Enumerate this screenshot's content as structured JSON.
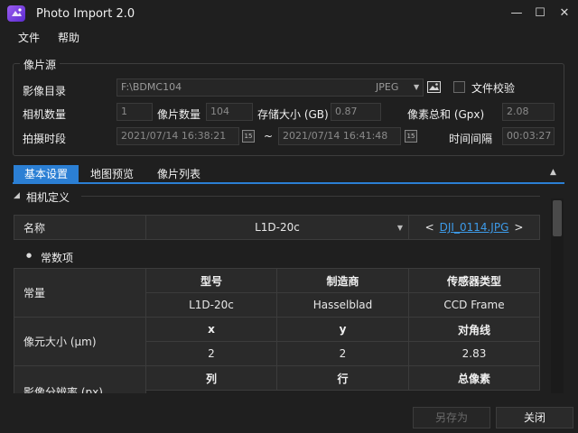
{
  "window": {
    "title": "Photo Import 2.0",
    "minimize": "—",
    "maximize": "☐",
    "close": "✕"
  },
  "menu": {
    "file": "文件",
    "help": "帮助"
  },
  "source": {
    "group_title": "像片源",
    "dir_label": "影像目录",
    "dir_value": "F:\\BDMC104",
    "format_value": "JPEG",
    "verify_label": "文件校验",
    "camera_count_label": "相机数量",
    "camera_count_value": "1",
    "photo_count_label": "像片数量",
    "photo_count_value": "104",
    "storage_label": "存储大小 (GB)",
    "storage_value": "0.87",
    "pixel_total_label": "像素总和 (Gpx)",
    "pixel_total_value": "2.08",
    "time_label": "拍摄时段",
    "time_start": "2021/07/14 16:38:21",
    "time_sep": "~",
    "time_end": "2021/07/14 16:41:48",
    "interval_label": "时间间隔",
    "interval_value": "00:03:27",
    "calendar_glyph": "15"
  },
  "tabs": [
    {
      "label": "基本设置"
    },
    {
      "label": "地图预览"
    },
    {
      "label": "像片列表"
    }
  ],
  "tab_collapse": "▲",
  "camera": {
    "section_title": "相机定义",
    "section_arrow": "◢",
    "name_label": "名称",
    "name_value": "L1D-20c",
    "prev": "<",
    "next": ">",
    "sample_image": "DJI_0114.JPG",
    "constants_title": "常数项",
    "constants_bullet": "●",
    "rows": {
      "const_label": "常量",
      "const_headers": [
        "型号",
        "制造商",
        "传感器类型"
      ],
      "const_values": [
        "L1D-20c",
        "Hasselblad",
        "CCD Frame"
      ],
      "pixel_label": "像元大小 (μm)",
      "pixel_headers": [
        "x",
        "y",
        "对角线"
      ],
      "pixel_values": [
        "2",
        "2",
        "2.83"
      ],
      "res_label": "影像分辨率 (px)",
      "res_headers": [
        "列",
        "行",
        "总像素"
      ]
    }
  },
  "footer": {
    "save_as": "另存为",
    "close": "关闭"
  }
}
